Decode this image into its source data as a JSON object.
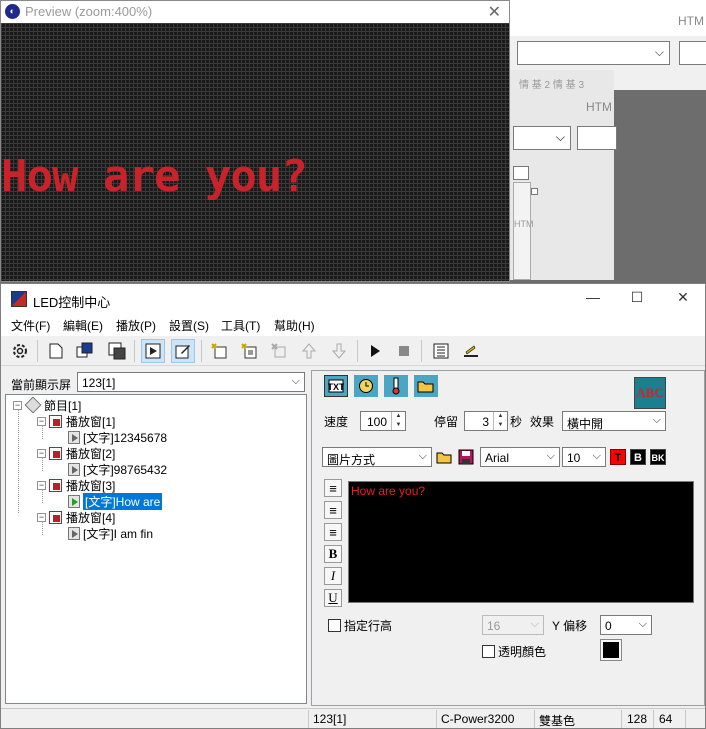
{
  "background": {
    "htm_label_1": "HTM",
    "htm_label_2": "HTM",
    "tabs_text": "情 基 2  情 基 3",
    "htm_label_3": "HTM"
  },
  "preview": {
    "title": "Preview (zoom:400%)",
    "led_text": "How are you?",
    "led_color": "#c8232a"
  },
  "main": {
    "title": "LED控制中心",
    "window_buttons": {
      "minimize": "—",
      "maximize": "☐",
      "close": "✕"
    },
    "menu": [
      "文件(F)",
      "編輯(E)",
      "播放(P)",
      "設置(S)",
      "工具(T)",
      "幫助(H)"
    ],
    "current_screen_label": "當前顯示屏",
    "current_screen_value": "123[1]",
    "tree": {
      "root": "節目[1]",
      "windows": [
        {
          "label": "播放窗[1]",
          "child": "[文字]12345678"
        },
        {
          "label": "播放窗[2]",
          "child": "[文字]98765432"
        },
        {
          "label": "播放窗[3]",
          "child": "[文字]How are"
        },
        {
          "label": "播放窗[4]",
          "child": "[文字]I am fin"
        }
      ],
      "selected_index": 2
    },
    "right": {
      "speed_label": "速度",
      "speed_value": "100",
      "stay_label": "停留",
      "stay_value": "3",
      "stay_unit": "秒",
      "effect_label": "效果",
      "effect_value": "橫中開",
      "mode_value": "圖片方式",
      "font_value": "Arial",
      "size_value": "10",
      "color_buttons": [
        "T",
        "B",
        "BK"
      ],
      "color_button_colors": [
        "#ff0000",
        "#000000",
        "#000000"
      ],
      "editor_text": "How are you?",
      "line_height_label": "指定行高",
      "line_height_value": "16",
      "y_offset_label": "Y 偏移",
      "y_offset_value": "0",
      "transparent_label": "透明顏色",
      "abc_logo": "ABC"
    },
    "status": {
      "screen": "123[1]",
      "controller": "C-Power3200",
      "color_mode": "雙基色",
      "width": "128",
      "height": "64"
    }
  }
}
